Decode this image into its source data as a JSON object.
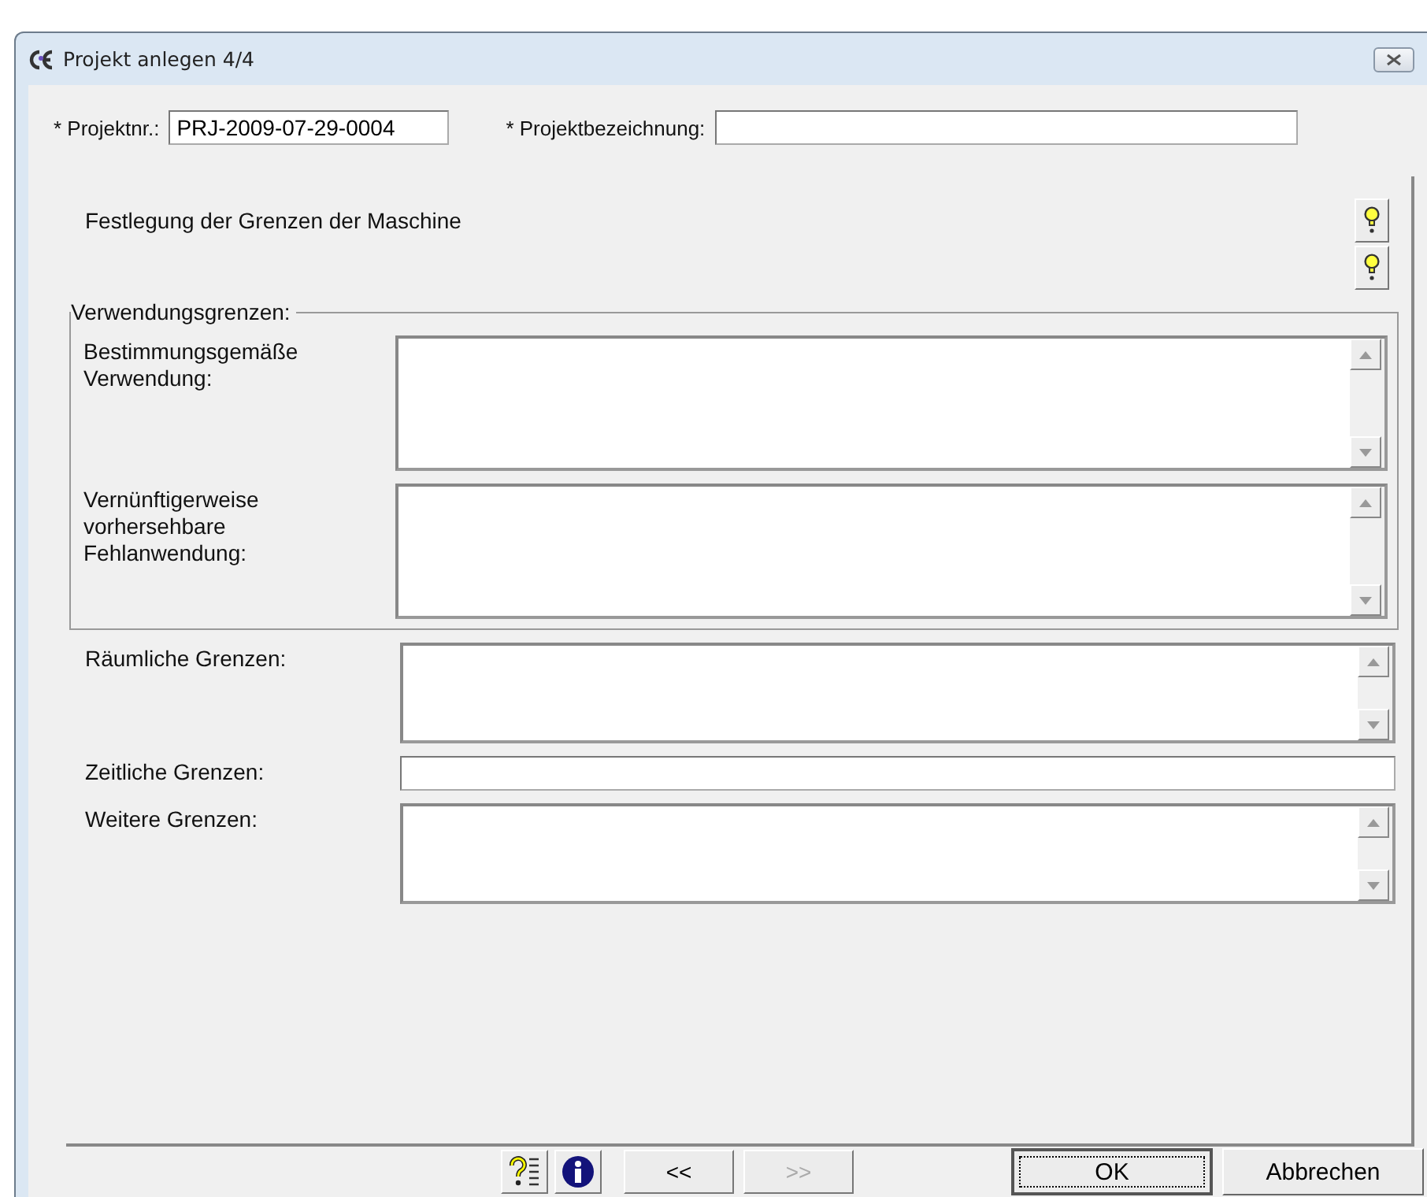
{
  "window": {
    "title": "Projekt anlegen 4/4"
  },
  "header_fields": [
    {
      "label": "* Projektnr.:",
      "value": "PRJ-2009-07-29-0004"
    },
    {
      "label": "* Projektbezeichnung:"
    }
  ],
  "section_title": "Festlegung der Grenzen der Maschine",
  "group": {
    "label": "Verwendungsgrenzen:",
    "rows": [
      {
        "label": "Bestimmungsgemäße Verwendung:",
        "kind": "textarea"
      },
      {
        "label": "Vernünftigerweise vorhersehbare Fehlanwendung:",
        "kind": "textarea"
      }
    ]
  },
  "rows": [
    {
      "label": "Räumliche Grenzen:",
      "kind": "textarea"
    },
    {
      "label": "Zeitliche Grenzen:",
      "kind": "input"
    },
    {
      "label": "Weitere Grenzen:",
      "kind": "textarea"
    }
  ],
  "nav_buttons": [
    {
      "label": "<<",
      "disabled": false
    },
    {
      "label": ">>",
      "disabled": true
    }
  ],
  "action_buttons": [
    {
      "label": "OK",
      "default": true
    },
    {
      "label": "Abbrechen",
      "default": false
    }
  ]
}
